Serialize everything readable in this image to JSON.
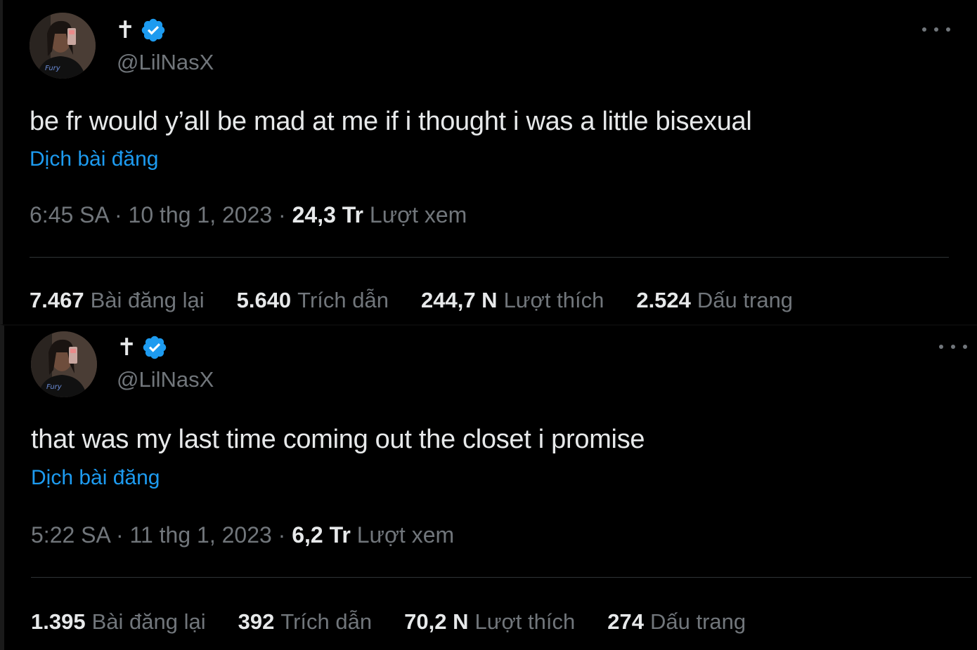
{
  "tweets": [
    {
      "display_name": "✝",
      "handle": "@LilNasX",
      "text": "be fr would y’all be mad at me if i thought i was a little bisexual",
      "translate_label": "Dịch bài đăng",
      "time": "6:45 SA",
      "date": "10 thg 1, 2023",
      "views_count": "24,3 Tr",
      "views_label": "Lượt xem",
      "stats": {
        "reposts": {
          "count": "7.467",
          "label": "Bài đăng lại"
        },
        "quotes": {
          "count": "5.640",
          "label": "Trích dẫn"
        },
        "likes": {
          "count": "244,7 N",
          "label": "Lượt thích"
        },
        "bookmarks": {
          "count": "2.524",
          "label": "Dấu trang"
        }
      }
    },
    {
      "display_name": "✝",
      "handle": "@LilNasX",
      "text": "that was my last time coming out the closet i promise",
      "translate_label": "Dịch bài đăng",
      "time": "5:22 SA",
      "date": "11 thg 1, 2023",
      "views_count": "6,2 Tr",
      "views_label": "Lượt xem",
      "stats": {
        "reposts": {
          "count": "1.395",
          "label": "Bài đăng lại"
        },
        "quotes": {
          "count": "392",
          "label": "Trích dẫn"
        },
        "likes": {
          "count": "70,2 N",
          "label": "Lượt thích"
        },
        "bookmarks": {
          "count": "274",
          "label": "Dấu trang"
        }
      }
    }
  ],
  "separator": " · ",
  "icons": {
    "verified": "verified-badge-icon",
    "more": "more-options-icon"
  },
  "colors": {
    "background": "#000000",
    "text_primary": "#e7e9ea",
    "text_secondary": "#71767b",
    "link": "#1d9bf0",
    "verified": "#1d9bf0",
    "divider": "#2f3336"
  }
}
